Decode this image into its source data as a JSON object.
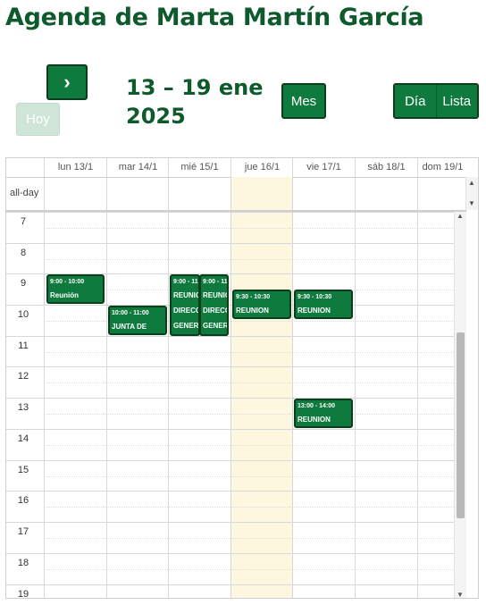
{
  "title": "Agenda de Marta Martín García",
  "toolbar": {
    "next_label": "›",
    "today_label": "Hoy",
    "range_line1": "13 – 19 ene",
    "range_line2": "2025",
    "month_label": "Mes",
    "day_label": "Día",
    "list_label": "Lista"
  },
  "calendar": {
    "allday_label": "all-day",
    "days": [
      "lun 13/1",
      "mar 14/1",
      "mié 15/1",
      "jue 16/1",
      "vie 17/1",
      "sáb 18/1",
      "dom 19/1"
    ],
    "hours": [
      "7",
      "8",
      "9",
      "10",
      "11",
      "12",
      "13",
      "14",
      "15",
      "16",
      "17",
      "18",
      "19"
    ],
    "events": [
      {
        "time": "9:00 - 10:00",
        "name": "Reunión",
        "name2": ""
      },
      {
        "time": "10:00 - 11:00",
        "name": "JUNTA DE",
        "name2": ""
      },
      {
        "time": "9:00 - 11",
        "name": "REUNIO",
        "name2": "DIRECC",
        "name3": "GENERA"
      },
      {
        "time": "9:00 - 11",
        "name": "REUNIO",
        "name2": "DIRECC",
        "name3": "GENER"
      },
      {
        "time": "9:30 - 10:30",
        "name": "REUNION",
        "name2": ""
      },
      {
        "time": "9:30 - 10:30",
        "name": "REUNION",
        "name2": ""
      },
      {
        "time": "13:00 - 14:00",
        "name": "REUNION",
        "name2": ""
      }
    ]
  },
  "colors": {
    "primary": "#0f7a3d",
    "title": "#0e5a2c",
    "today_bg": "#fdf7e0"
  },
  "icons": {
    "next": "chevron-right-icon",
    "scroll_up": "triangle-up-icon",
    "scroll_down": "triangle-down-icon"
  }
}
